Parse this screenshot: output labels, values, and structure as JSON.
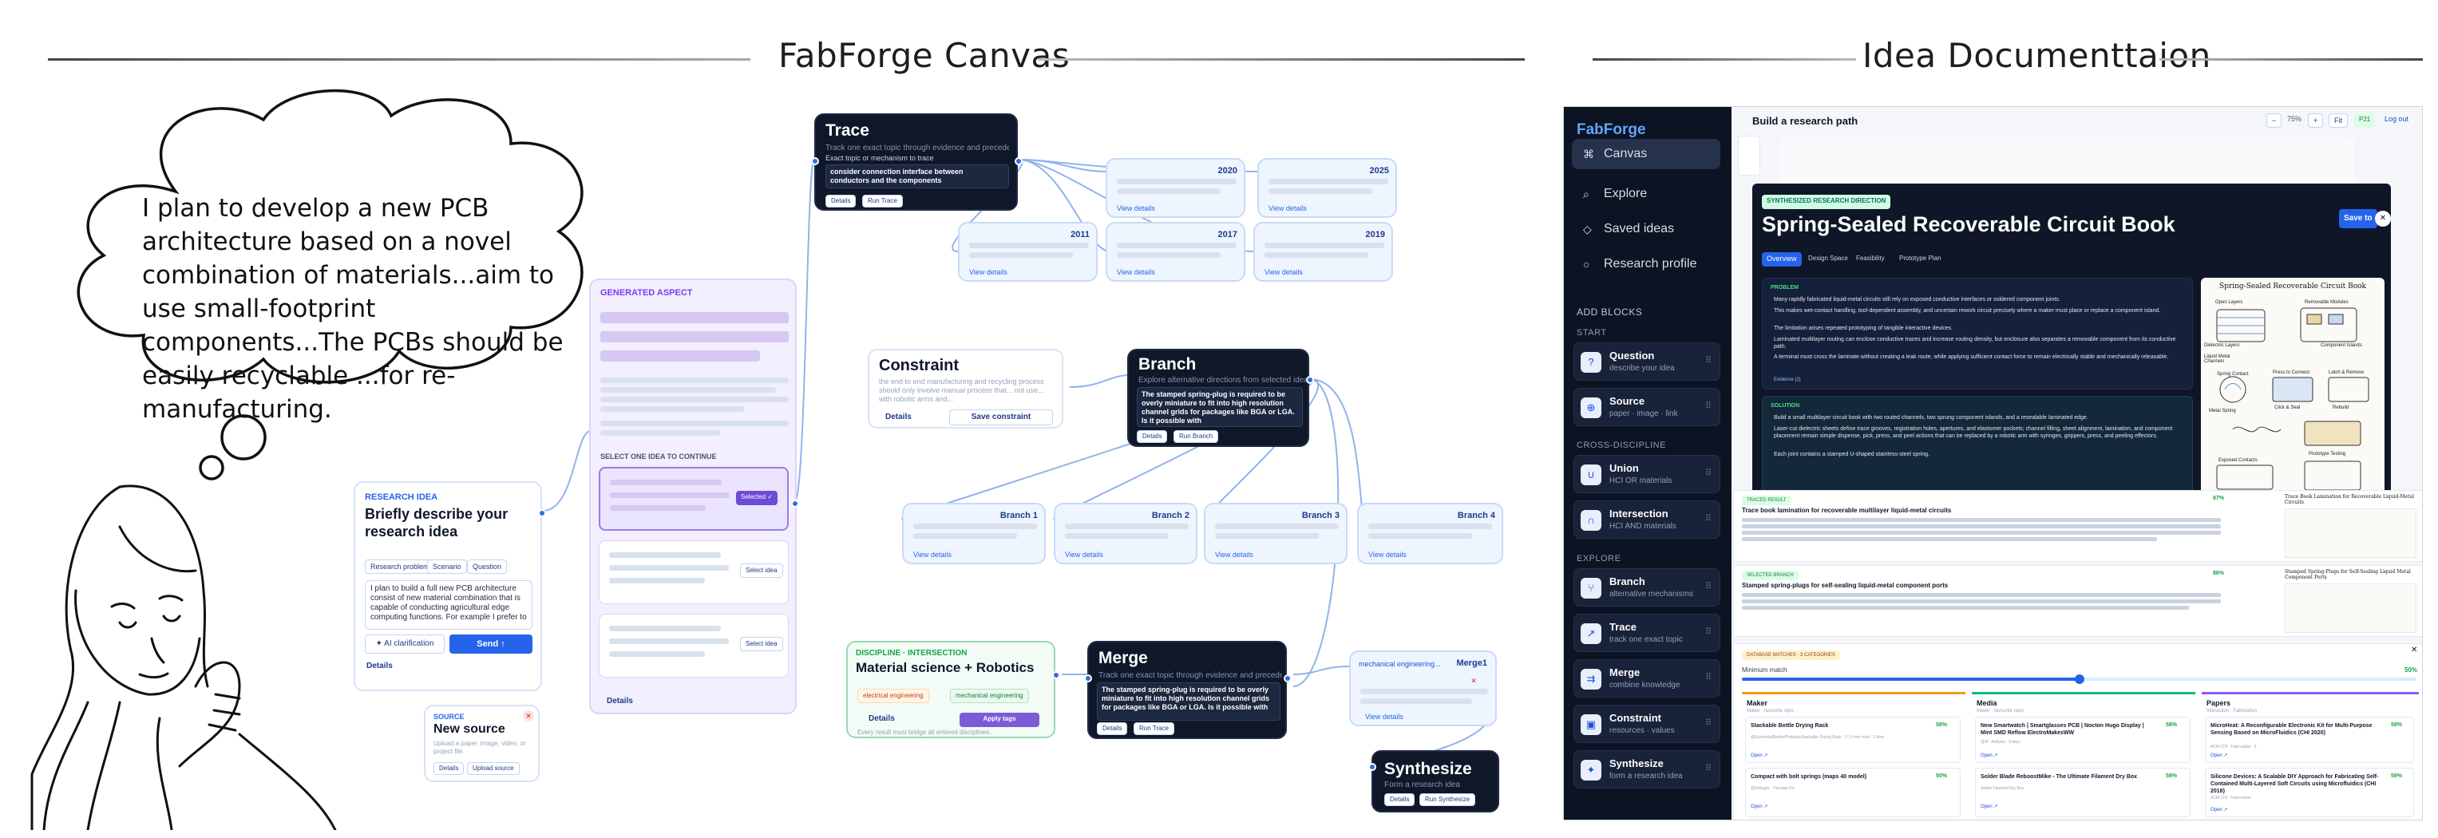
{
  "headings": {
    "canvas": "FabForge Canvas",
    "docs": "Idea Documenttaion"
  },
  "thought": {
    "text": "I plan to develop a new PCB architecture based on a novel combination of materials...aim to use small-footprint components...The PCBs should be easily recyclable ...for re-manufacturing."
  },
  "research_idea": {
    "kicker": "RESEARCH IDEA",
    "title": "Briefly describe your research idea",
    "chips": [
      "Research problem",
      "Scenario",
      "Question"
    ],
    "input_text": "I plan to build a full new PCB architecture consist of new material combination that is capable of conducting agricultural edge computing functions. For example I prefer to",
    "clarify_label": "✦ AI clarification",
    "send_label": "Send ↑",
    "details_label": "Details"
  },
  "source": {
    "kicker": "SOURCE",
    "title": "New source",
    "desc": "Upload a paper, image, video, or project file.",
    "details_label": "Details",
    "upload_label": "Upload source"
  },
  "aspect": {
    "kicker": "GENERATED ASPECT",
    "select_label": "SELECT ONE IDEA TO CONTINUE",
    "selected_label": "Selected ✓",
    "select_idea_label": "Select idea",
    "details_label": "Details"
  },
  "trace": {
    "title": "Trace",
    "sub": "Track one exact topic through evidence and precedents",
    "field_label": "Exact topic or mechanism to trace",
    "field_value": "consider connection interface between conductors and the components",
    "details_label": "Details",
    "run_label": "Run Trace",
    "years": [
      "2020",
      "2025",
      "2011",
      "2017",
      "2019"
    ],
    "view_label": "View details"
  },
  "constraint": {
    "title": "Constraint",
    "text": "the end to end manufacturing and recycling process should only involve manual process that... not use... with robotic arms and...",
    "details_label": "Details",
    "save_label": "Save constraint"
  },
  "branch": {
    "title": "Branch",
    "sub": "Explore alternative directions from selected idea",
    "text": "The stamped spring-plug is required to be overly miniature to fit into high resolution channel grids for packages like BGA or LGA. Is it possible with",
    "details_label": "Details",
    "run_label": "Run Branch",
    "children": [
      "Branch 1",
      "Branch 2",
      "Branch 3",
      "Branch 4"
    ],
    "view_label": "View details"
  },
  "intersection": {
    "kicker": "DISCIPLINE · INTERSECTION",
    "title": "Material science + Robotics",
    "tags": [
      "electrical engineering",
      "mechanical engineering"
    ],
    "details_label": "Details",
    "apply_label": "Apply tags",
    "note": "Every result must bridge all entered disciplines."
  },
  "merge": {
    "title": "Merge",
    "sub": "Track one exact topic through evidence and precedents",
    "text": "The stamped spring-plug is required to be overly miniature to fit into high resolution channel grids for packages like BGA or LGA. Is it possible with",
    "details_label": "Details",
    "run_label": "Run Trace",
    "result_tag": "mechanical engineering...",
    "result_title": "Merge1",
    "view_label": "View details"
  },
  "synthesize": {
    "title": "Synthesize",
    "sub": "Form a research idea",
    "details_label": "Details",
    "run_label": "Run Synthesize"
  },
  "app": {
    "brand": "FabForge",
    "nav": [
      {
        "icon": "⌘",
        "label": "Canvas"
      },
      {
        "icon": "⌕",
        "label": "Explore"
      },
      {
        "icon": "◇",
        "label": "Saved ideas"
      },
      {
        "icon": "○",
        "label": "Research profile"
      }
    ],
    "add_blocks_label": "ADD BLOCKS",
    "start_label": "START",
    "cross_label": "CROSS-DISCIPLINE",
    "explore_label": "EXPLORE",
    "blocks": [
      {
        "title": "Question",
        "sub": "describe your idea"
      },
      {
        "title": "Source",
        "sub": "paper · image · link"
      },
      {
        "title": "Union",
        "sub": "HCI OR materials"
      },
      {
        "title": "Intersection",
        "sub": "HCI AND materials"
      },
      {
        "title": "Branch",
        "sub": "alternative mechanisms"
      },
      {
        "title": "Trace",
        "sub": "track one exact topic"
      },
      {
        "title": "Merge",
        "sub": "combine knowledge"
      },
      {
        "title": "Constraint",
        "sub": "resources · values"
      },
      {
        "title": "Synthesize",
        "sub": "form a research idea"
      }
    ],
    "topbar_title": "Build a research path",
    "zoom": "75%",
    "zoom_minus": "−",
    "zoom_plus": "+",
    "fit_label": "Fit",
    "user_initials": "P21",
    "logout_label": "Log out",
    "proj_kicker": "SYNTHESIZED RESEARCH DIRECTION",
    "proj_title": "Spring-Sealed Recoverable Circuit Book",
    "save_label": "Save to",
    "tabs": [
      "Overview",
      "Design Space",
      "Feasibility",
      "Prototype Plan"
    ],
    "problem_label": "PROBLEM",
    "problem_bullets": [
      "Many rapidly fabricated liquid-metal circuits still rely on exposed conductive interfaces or soldered component joints.",
      "This makes wet-contact handling, tool-dependent assembly, and uncertain rework circuit precisely where a maker must place or replace a component island.",
      "The limitation arises repeated prototyping of tangible interactive devices.",
      "Laminated multilayer routing can enclose conductive traces and increase routing density, but enclosure also separates a removable component from its conductive path.",
      "A terminal must cross the laminate without creating a leak route, while applying sufficient contact force to remain electrically stable and mechanically releasable."
    ],
    "evidence_label": "Evidence (2)",
    "solution_label": "SOLUTION",
    "solution_bullets": [
      "Build a small multilayer circuit book with two routed channels, two sprung component islands, and a resealable laminated edge.",
      "Laser-cut dielectric sheets define trace grooves, registration holes, apertures, and elastomer pockets; channel filling, sheet alignment, lamination, and component placement remain simple dispense, pick, press, and peel actions that can be replaced by a robotic arm with syringes, grippers, press, and peeling effectors.",
      "Each joint contains a stamped U-shaped stainless-steel spring."
    ],
    "sketch_title": "Spring-Sealed Recoverable Circuit Book",
    "sketch_labels": [
      "Open Layers",
      "Removable Modules",
      "Dielectric Layers",
      "Component Islands",
      "Liquid Metal Channels",
      "Spring Contact",
      "Press to Connect",
      "Latch & Remove",
      "Metal Spring",
      "Click & Seal",
      "Rebuild",
      "Prototype Testing",
      "Exposed Contacts"
    ],
    "trace_kicker": "TRACED RESULT",
    "trace_pct": "87%",
    "trace_item_title": "Trace book lamination for recoverable multilayer liquid-metal circuits",
    "trace_sketch_title": "Trace Book Lamination for Recoverable Liquid-Metal Circuits",
    "merge_kicker": "SELECTED BRANCH",
    "merge_pct": "86%",
    "merge_item_title": "Stamped spring-plugs for self-sealing liquid-metal component ports",
    "merge_sketch_title": "Stamped Spring-Plugs for Self-Sealing Liquid Metal Component Ports",
    "db_kicker": "DATABASE MATCHES · 3 CATEGORIES",
    "min_match_label": "Minimum match",
    "min_match_value": "50%",
    "min_match_fill": 0.5,
    "columns": [
      {
        "name": "Maker",
        "sub": "Maker · favourite repo",
        "items": [
          {
            "title": "Stackable Bottle Drying Rack",
            "pct": "58%",
            "meta": "@ExistentialBeetle/ProbablyStackable Drying Rack · 3 | 5 min read · 1 likes"
          },
          {
            "title": "Compact with bolt springs (maps 40 model)",
            "pct": "50%",
            "meta": "@Dekogin · Tuesday Kit"
          }
        ]
      },
      {
        "name": "Media",
        "sub": "Maker · favourite repo",
        "items": [
          {
            "title": "New Smartwatch | Smartglasses PCB | Nocton Hugo Display | Mint SMD Reflow ElectroMakesWW",
            "pct": "58%",
            "meta": "@3f · Arduino · 9 days"
          },
          {
            "title": "Solder Blade ReboostMike - The Ultimate Filament Dry Box",
            "pct": "58%",
            "meta": "Solder Filament Dry Box"
          }
        ]
      },
      {
        "name": "Papers",
        "sub": "Interaction · Fabrication",
        "items": [
          {
            "title": "MicroHeat: A Reconfigurable Electronic Kit for Multi-Purpose Sensing Based on MicroFluidics (CHI 2020)",
            "pct": "58%",
            "meta": "ACM CHI · Fabrication · 9"
          },
          {
            "title": "Silicone Devices: A Scalable DIY Approach for Fabricating Self-Contained Multi-Layered Soft Circuits using Microfluidics (CHI 2018)",
            "pct": "58%",
            "meta": "ACM CHI · Fabrication"
          }
        ]
      }
    ],
    "open_label": "Open ↗"
  }
}
